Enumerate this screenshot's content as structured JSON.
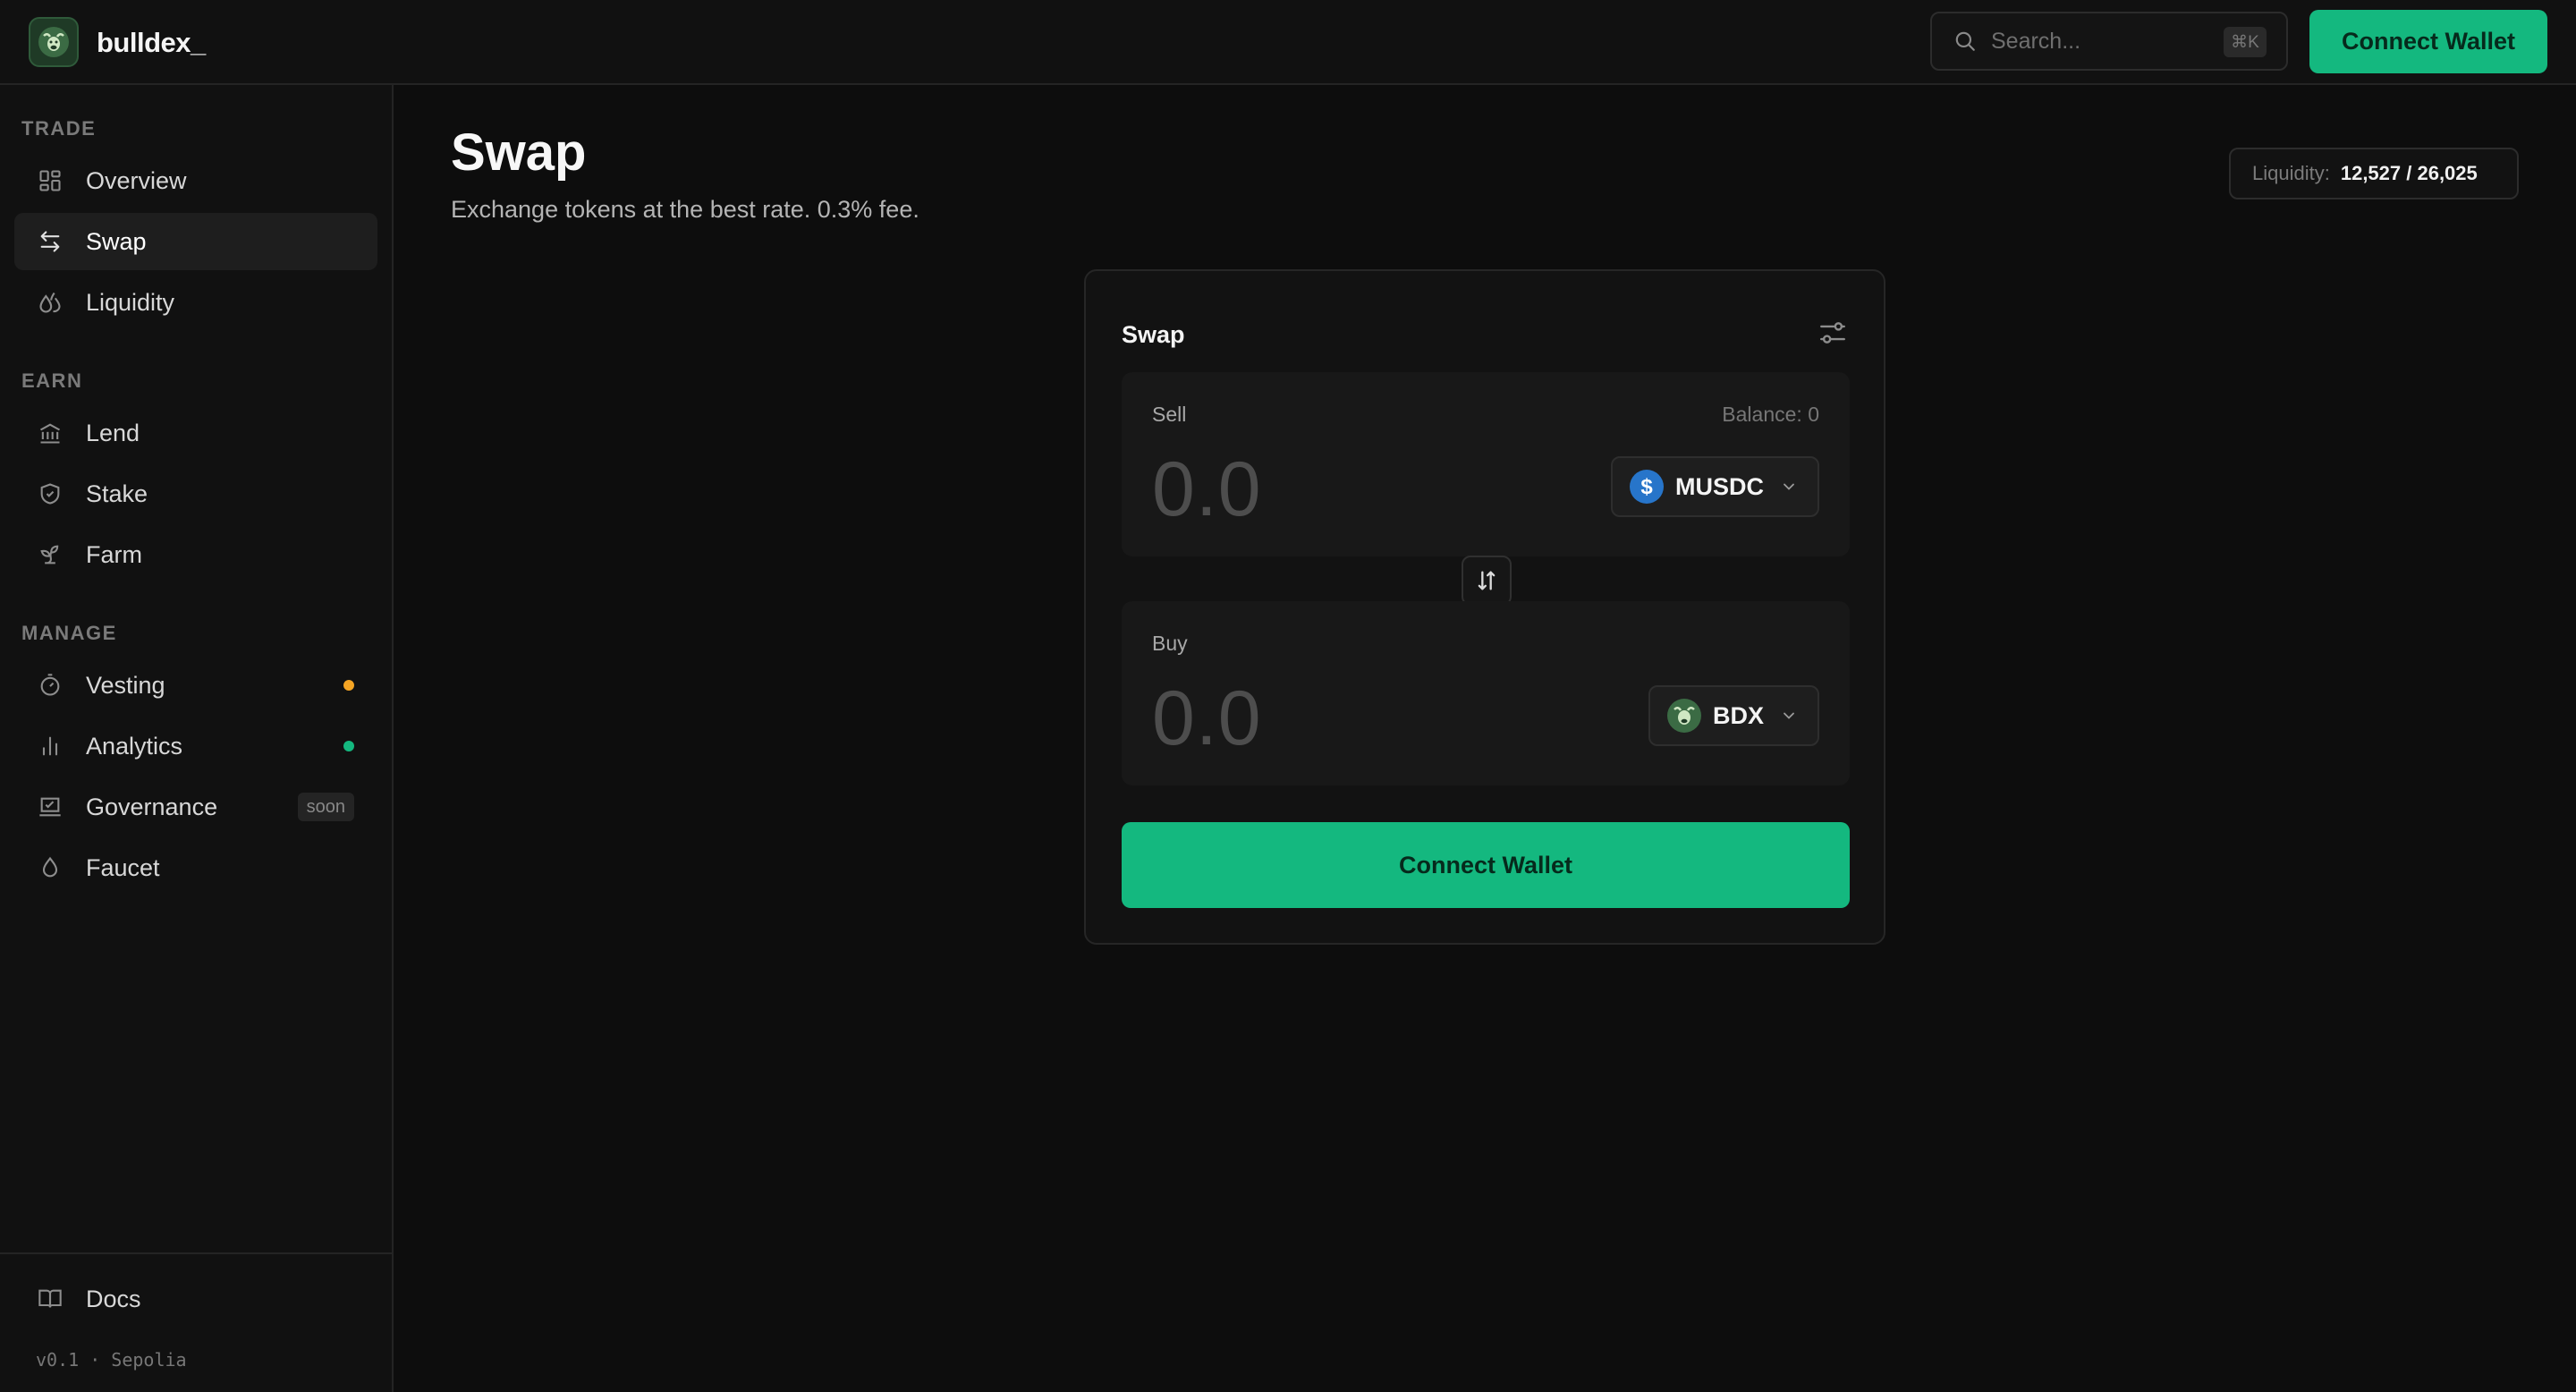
{
  "header": {
    "brand": "bulldex_",
    "search_placeholder": "Search...",
    "search_shortcut": "⌘K",
    "connect_label": "Connect Wallet"
  },
  "sidebar": {
    "sections": [
      {
        "label": "TRADE",
        "items": [
          {
            "label": "Overview",
            "icon": "grid-icon"
          },
          {
            "label": "Swap",
            "icon": "swap-arrows-icon",
            "active": true
          },
          {
            "label": "Liquidity",
            "icon": "droplets-icon"
          }
        ]
      },
      {
        "label": "EARN",
        "items": [
          {
            "label": "Lend",
            "icon": "bank-icon"
          },
          {
            "label": "Stake",
            "icon": "shield-icon"
          },
          {
            "label": "Farm",
            "icon": "sprout-icon"
          }
        ]
      },
      {
        "label": "MANAGE",
        "items": [
          {
            "label": "Vesting",
            "icon": "timer-icon",
            "dot_color": "#f5a524"
          },
          {
            "label": "Analytics",
            "icon": "bar-chart-icon",
            "dot_color": "#14b87f"
          },
          {
            "label": "Governance",
            "icon": "ballot-icon",
            "badge": "soon"
          },
          {
            "label": "Faucet",
            "icon": "droplet-icon"
          }
        ]
      }
    ],
    "footer_item": {
      "label": "Docs",
      "icon": "book-icon"
    },
    "version": "v0.1 · Sepolia"
  },
  "main": {
    "title": "Swap",
    "subtitle": "Exchange tokens at the best rate. 0.3% fee.",
    "liquidity_label": "Liquidity:",
    "liquidity_value": "12,527 / 26,025"
  },
  "swap_card": {
    "title": "Swap",
    "sell": {
      "label": "Sell",
      "balance": "Balance: 0",
      "amount": "0.0",
      "token": "MUSDC"
    },
    "buy": {
      "label": "Buy",
      "amount": "0.0",
      "token": "BDX"
    },
    "connect_label": "Connect Wallet"
  },
  "colors": {
    "accent": "#14b87f",
    "usdc_blue": "#2775ca",
    "vesting_dot": "#f5a524",
    "analytics_dot": "#14b87f"
  }
}
